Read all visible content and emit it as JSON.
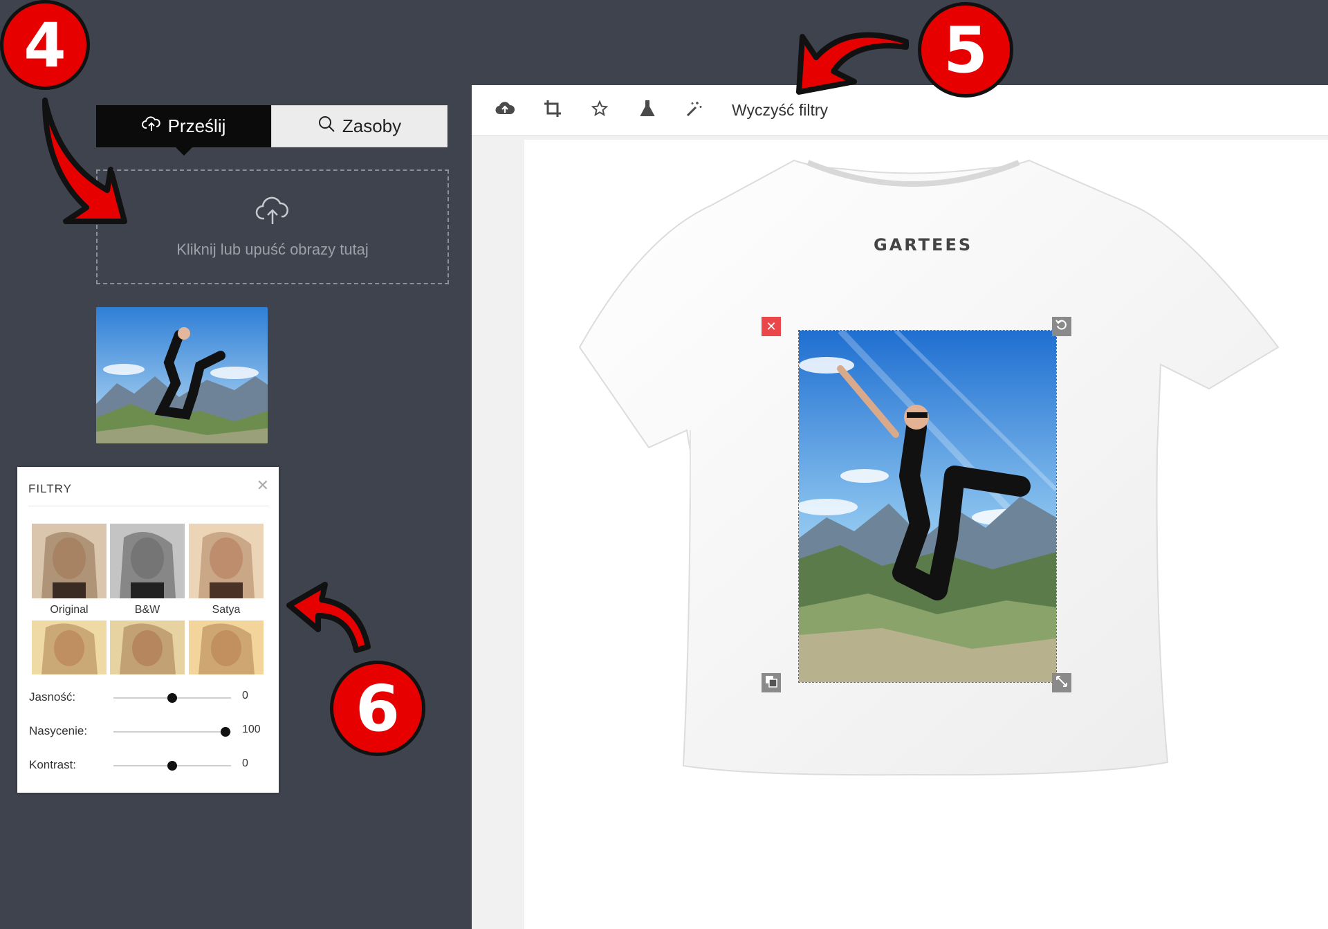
{
  "sidebar": {
    "tabs": [
      {
        "label": "Prześlij",
        "icon": "cloud-upload-icon",
        "active": true
      },
      {
        "label": "Zasoby",
        "icon": "search-icon",
        "active": false
      }
    ],
    "dropzone_text": "Kliknij lub upuść obrazy tutaj"
  },
  "filters": {
    "title": "FILTRY",
    "tiles": [
      {
        "label": "Original"
      },
      {
        "label": "B&W"
      },
      {
        "label": "Satya"
      },
      {
        "label": ""
      },
      {
        "label": ""
      },
      {
        "label": ""
      }
    ],
    "sliders": [
      {
        "label": "Jasność:",
        "value": "0",
        "position": 0.5
      },
      {
        "label": "Nasycenie:",
        "value": "100",
        "position": 0.95
      },
      {
        "label": "Kontrast:",
        "value": "0",
        "position": 0.5
      }
    ]
  },
  "toolbar": {
    "icons": [
      "cloud-upload-icon",
      "crop-icon",
      "star-icon",
      "flask-icon",
      "magic-wand-icon"
    ],
    "clear_filters_label": "Wyczyść filtry"
  },
  "canvas": {
    "shirt_brand": "GARTEES"
  },
  "annotations": {
    "badge_4": "4",
    "badge_5": "5",
    "badge_6": "6"
  },
  "colors": {
    "background": "#3f434d",
    "accent_red": "#e60000",
    "delete_handle": "#e9474a"
  }
}
